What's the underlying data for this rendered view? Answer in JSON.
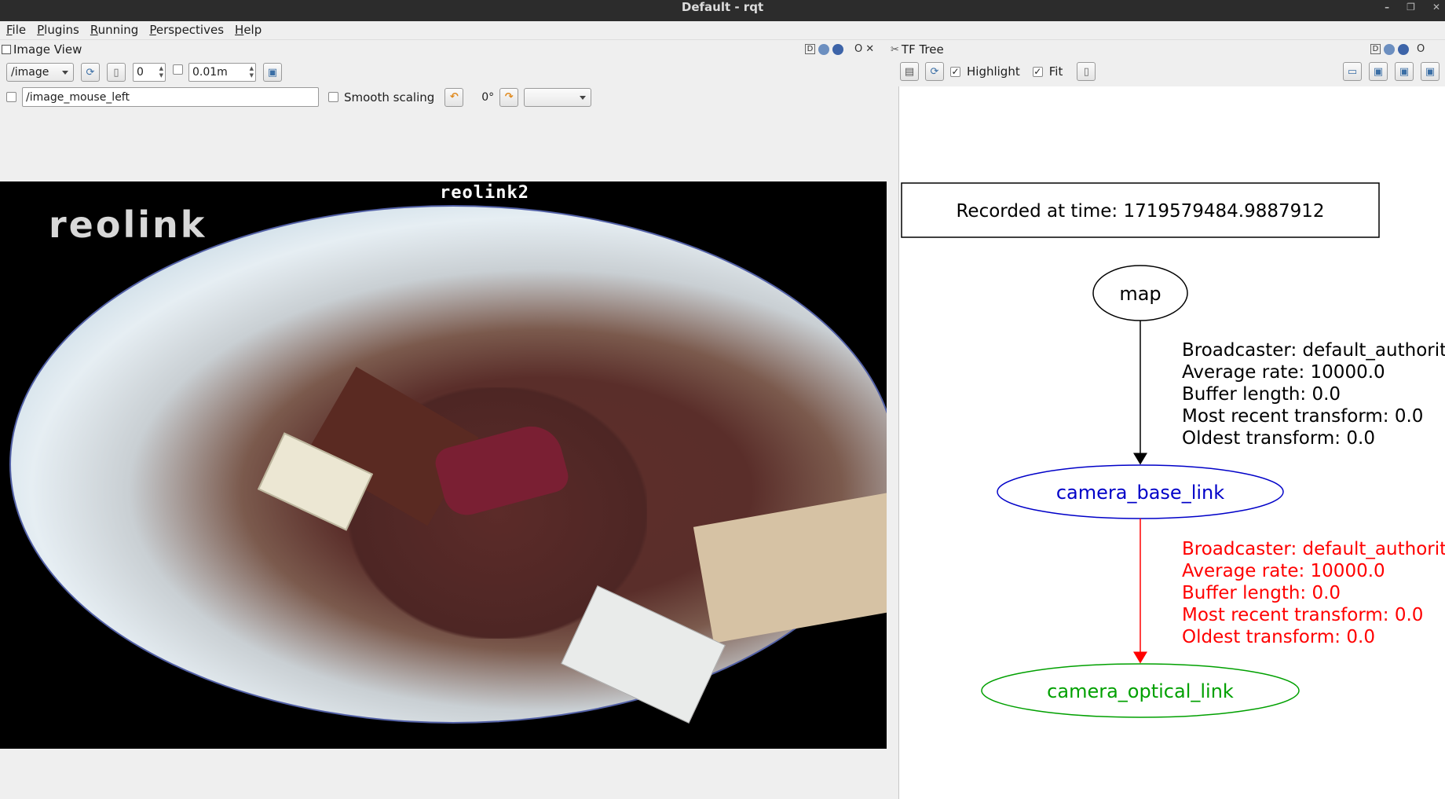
{
  "window": {
    "title": "Default - rqt",
    "controls": [
      "–",
      "❐",
      "✕"
    ]
  },
  "menu": [
    "File",
    "Plugins",
    "Running",
    "Perspectives",
    "Help"
  ],
  "image_view": {
    "title": "Image View",
    "dock_buttons": {
      "d": "D",
      "o": "O",
      "x": "✕"
    },
    "topic": "/image",
    "spin_value": "0",
    "scale_value": "0.01m",
    "mouse_topic": "/image_mouse_left",
    "smooth_scaling_label": "Smooth scaling",
    "rotation": "0°",
    "image": {
      "watermark_title": "reolink2",
      "watermark_logo": "reolink"
    }
  },
  "tf_tree": {
    "title": "TF Tree",
    "dock_buttons": {
      "d": "D",
      "o": "O"
    },
    "highlight_label": "Highlight",
    "fit_label": "Fit",
    "recorded_at": "Recorded at time: 1719579484.9887912",
    "nodes": [
      {
        "name": "map",
        "color": "#000000"
      },
      {
        "name": "camera_base_link",
        "color": "#0000c8"
      },
      {
        "name": "camera_optical_link",
        "color": "#00a000"
      }
    ],
    "edges": [
      {
        "color": "#000000",
        "labels": [
          "Broadcaster: default_authority",
          "Average rate: 10000.0",
          "Buffer length: 0.0",
          "Most recent transform: 0.0",
          "Oldest transform: 0.0"
        ]
      },
      {
        "color": "#ff0000",
        "labels": [
          "Broadcaster: default_authority",
          "Average rate: 10000.0",
          "Buffer length: 0.0",
          "Most recent transform: 0.0",
          "Oldest transform: 0.0"
        ]
      }
    ]
  }
}
